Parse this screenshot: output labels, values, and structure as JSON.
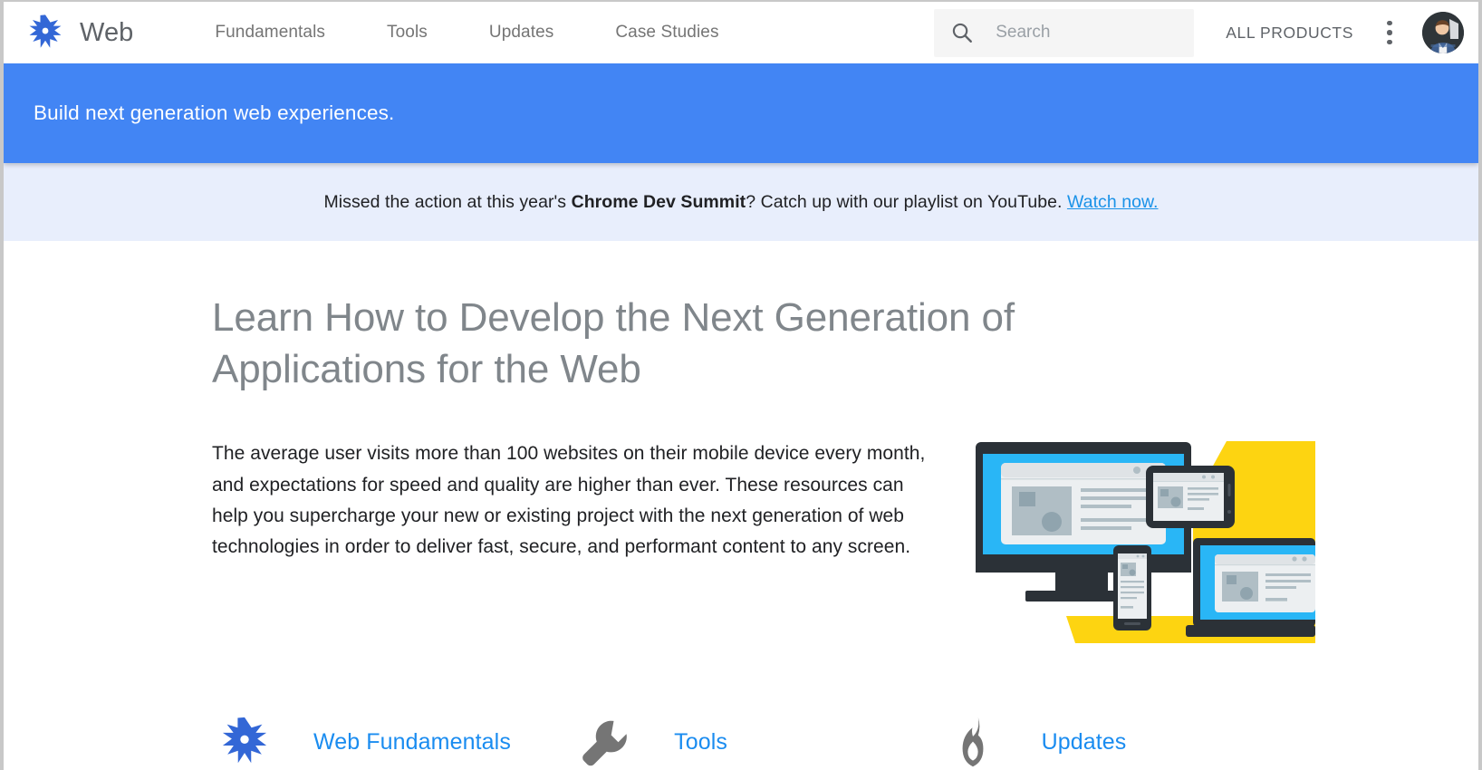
{
  "header": {
    "logo_icon": "web-asterisk-logo",
    "brand_title": "Web",
    "nav_items": [
      {
        "label": "Fundamentals"
      },
      {
        "label": "Tools"
      },
      {
        "label": "Updates"
      },
      {
        "label": "Case Studies"
      }
    ],
    "search": {
      "icon": "search-icon",
      "placeholder": "Search",
      "value": ""
    },
    "all_products_label": "ALL PRODUCTS",
    "overflow_icon": "kebab-menu-icon",
    "avatar_icon": "user-avatar-photo"
  },
  "hero_banner": {
    "text": "Build next generation web experiences.",
    "background_color": "#4285f4",
    "text_color": "#ffffff"
  },
  "notice_bar": {
    "background_color": "#e8eefc",
    "text_before": "Missed the action at this year's ",
    "text_bold": "Chrome Dev Summit",
    "text_after": "? Catch up with our playlist on YouTube. ",
    "link_label": "Watch now.",
    "link_color": "#1a92e8"
  },
  "main": {
    "page_title": "Learn How to Develop the Next Generation of Applications for the Web",
    "page_title_color": "#80868b",
    "intro_paragraph": "The average user visits more than 100 websites on their mobile device every month, and expectations for speed and quality are higher than ever. These resources can help you supercharge your new or existing project with the next generation of web technologies in order to deliver fast, secure, and performant content to any screen.",
    "illustration": {
      "name": "multi-device-responsive-illustration",
      "colors": {
        "yellow": "#fdd411",
        "blue": "#29b6f6",
        "dark": "#2b3137",
        "light_gray": "#eceff1",
        "mid_gray": "#b0bec5"
      }
    },
    "cards": [
      {
        "icon": "web-asterisk-logo-icon",
        "label": "Web Fundamentals",
        "icon_color": "#3367d6"
      },
      {
        "icon": "wrench-icon",
        "label": "Tools",
        "icon_color": "#757575"
      },
      {
        "icon": "flame-icon",
        "label": "Updates",
        "icon_color": "#757575"
      }
    ],
    "card_link_color": "#1a8cf0"
  }
}
